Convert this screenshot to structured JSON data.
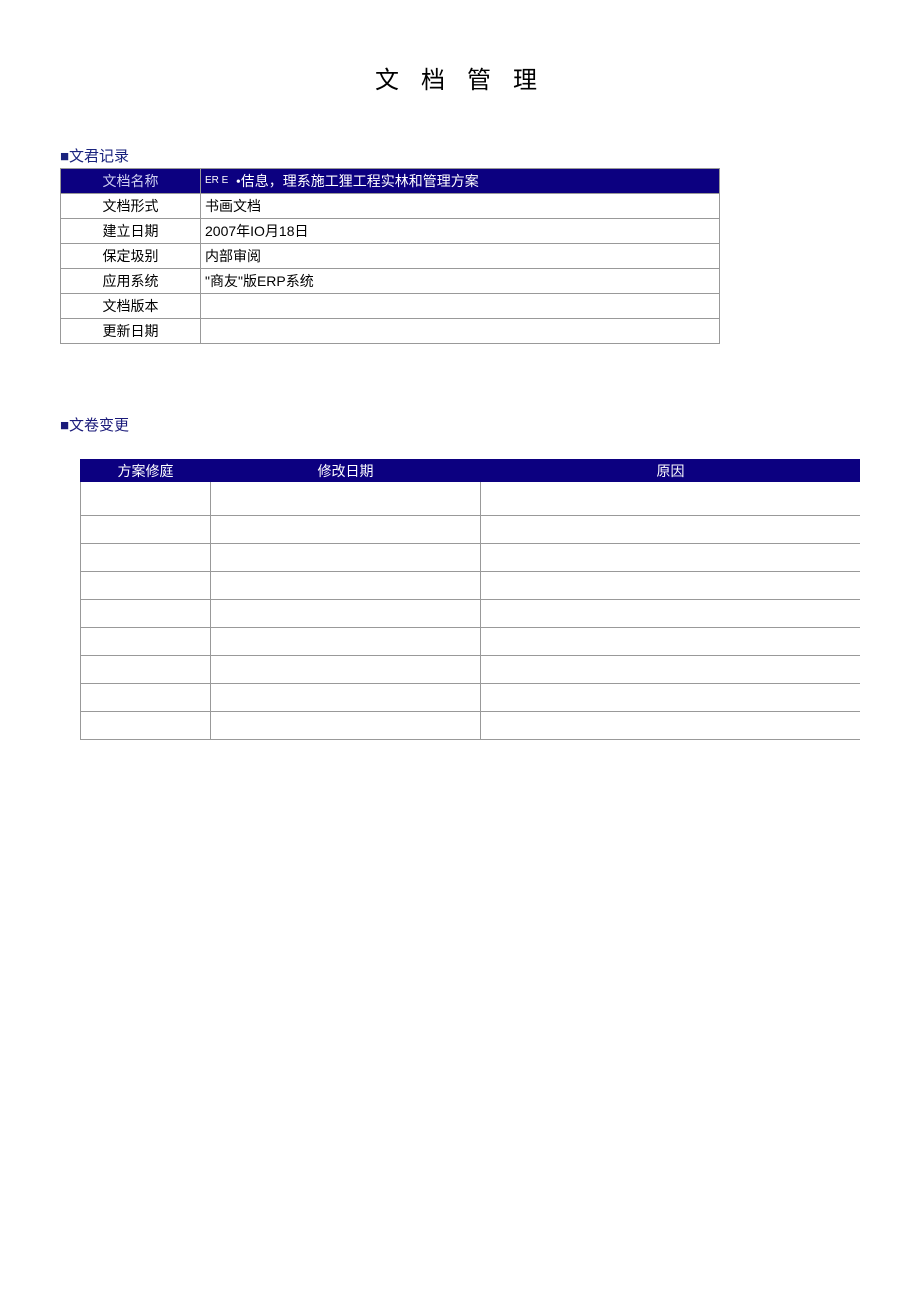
{
  "title": "文 档 管 理",
  "section1_label": "■文君记录",
  "record": {
    "header_left": "文档名称",
    "header_right_prefix": "ER E",
    "header_right_text": "•佶息，理系施工狸工程实林和管理方案",
    "rows": [
      {
        "label": "文档形式",
        "value": "书画文档"
      },
      {
        "label": "建立日期",
        "value": "2007年IO月18日"
      },
      {
        "label": "保定圾别",
        "value": "内部审阅"
      },
      {
        "label": "应用系统",
        "value": "\"商友\"版ERP系统",
        "indent": true
      },
      {
        "label": "文档版本",
        "value": ""
      },
      {
        "label": "更新日期",
        "value": ""
      }
    ]
  },
  "section2_label": "■文卷变更",
  "change_headers": {
    "col1": "方案修庭",
    "col2": "修改日期",
    "col3": "原因"
  },
  "change_rows_count": 9
}
